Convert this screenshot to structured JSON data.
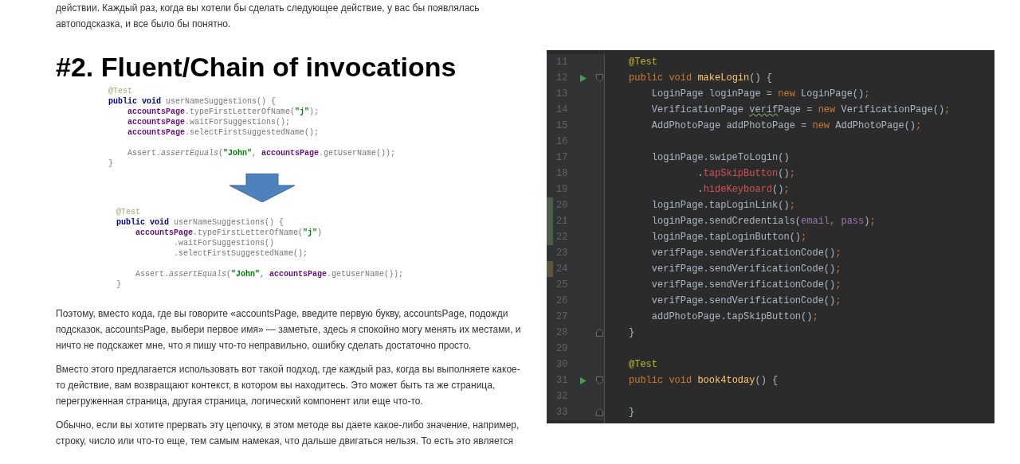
{
  "intro_paragraph": "действии. Каждый раз, когда вы хотели бы сделать следующее действие, у вас бы появлялась автоподсказка, и все было бы понятно.",
  "slide": {
    "title": "#2. Fluent/Chain of invocations",
    "code_before": [
      {
        "kind": "code",
        "segments": [
          {
            "kind": "ann",
            "text": "@Test"
          }
        ]
      },
      {
        "kind": "code",
        "segments": [
          {
            "kind": "kw",
            "text": "public void "
          },
          {
            "kind": "plain",
            "text": "userNameSuggestions() {"
          }
        ]
      },
      {
        "kind": "code",
        "segments": [
          {
            "kind": "obj",
            "text": "    accountsPage"
          },
          {
            "kind": "plain",
            "text": ".typeFirstLetterOfName("
          },
          {
            "kind": "str",
            "text": "\"j\""
          },
          {
            "kind": "plain",
            "text": ");"
          }
        ]
      },
      {
        "kind": "code",
        "segments": [
          {
            "kind": "obj",
            "text": "    accountsPage"
          },
          {
            "kind": "plain",
            "text": ".waitForSuggestions();"
          }
        ]
      },
      {
        "kind": "code",
        "segments": [
          {
            "kind": "obj",
            "text": "    accountsPage"
          },
          {
            "kind": "plain",
            "text": ".selectFirstSuggestedName();"
          }
        ]
      },
      {
        "kind": "blank"
      },
      {
        "kind": "code",
        "segments": [
          {
            "kind": "plain",
            "text": "    Assert."
          },
          {
            "kind": "italic",
            "text": "assertEquals"
          },
          {
            "kind": "plain",
            "text": "("
          },
          {
            "kind": "str",
            "text": "\"John\""
          },
          {
            "kind": "plain",
            "text": ", "
          },
          {
            "kind": "obj",
            "text": "accountsPage"
          },
          {
            "kind": "plain",
            "text": ".getUserName());"
          }
        ]
      },
      {
        "kind": "code",
        "segments": [
          {
            "kind": "plain",
            "text": "}"
          }
        ]
      }
    ],
    "code_after": [
      {
        "kind": "code",
        "segments": [
          {
            "kind": "ann",
            "text": "@Test"
          }
        ]
      },
      {
        "kind": "code",
        "segments": [
          {
            "kind": "kw",
            "text": "public void "
          },
          {
            "kind": "plain",
            "text": "userNameSuggestions() {"
          }
        ]
      },
      {
        "kind": "code",
        "segments": [
          {
            "kind": "obj",
            "text": "    accountsPage"
          },
          {
            "kind": "plain",
            "text": ".typeFirstLetterOfName("
          },
          {
            "kind": "str",
            "text": "\"j\""
          },
          {
            "kind": "plain",
            "text": ")"
          }
        ]
      },
      {
        "kind": "code",
        "segments": [
          {
            "kind": "plain",
            "text": "            .waitForSuggestions()"
          }
        ]
      },
      {
        "kind": "code",
        "segments": [
          {
            "kind": "plain",
            "text": "            .selectFirstSuggestedName();"
          }
        ]
      },
      {
        "kind": "blank"
      },
      {
        "kind": "code",
        "segments": [
          {
            "kind": "plain",
            "text": "    Assert."
          },
          {
            "kind": "italic",
            "text": "assertEquals"
          },
          {
            "kind": "plain",
            "text": "("
          },
          {
            "kind": "str",
            "text": "\"John\""
          },
          {
            "kind": "plain",
            "text": ", "
          },
          {
            "kind": "obj",
            "text": "accountsPage"
          },
          {
            "kind": "plain",
            "text": ".getUserName());"
          }
        ]
      },
      {
        "kind": "code",
        "segments": [
          {
            "kind": "plain",
            "text": "}"
          }
        ]
      }
    ]
  },
  "paragraphs": [
    "Поэтому, вместо кода, где вы говорите «accountsPage, введите первую букву, accountsPage, подожди подсказок, accountsPage, выбери первое имя» — заметьте, здесь я спокойно могу менять их местами, и ничто не подскажет мне, что я пишу что-то неправильно, ошибку сделать достаточно просто.",
    "Вместо этого предлагается использовать вот такой подход, где каждый раз, когда вы выполняете какое-то действие, вам возвращают контекст, в котором вы находитесь. Это может быть та же страница, перегруженная страница, другая страница, логический компонент или еще что-то.",
    "Обычно, если вы хотите прервать эту цепочку, в этом методе вы даете какое-либо значение, например, строку, число или что-то еще, тем самым намекая, что дальше двигаться нельзя. То есть это является"
  ],
  "editor": {
    "lines": [
      {
        "number": "11",
        "segments": [
          {
            "kind": "ann",
            "text": "@Test"
          }
        ]
      },
      {
        "number": "12",
        "run": true,
        "fold_start": true,
        "segments": [
          {
            "kind": "kw",
            "text": "public void "
          },
          {
            "kind": "fn",
            "text": "makeLogin"
          },
          {
            "kind": "plain",
            "text": "() {"
          }
        ]
      },
      {
        "number": "13",
        "segments": [
          {
            "kind": "plain",
            "text": "    LoginPage loginPage = "
          },
          {
            "kind": "kw",
            "text": "new "
          },
          {
            "kind": "plain",
            "text": "LoginPage()"
          },
          {
            "kind": "kw",
            "text": ";"
          }
        ]
      },
      {
        "number": "14",
        "segments": [
          {
            "kind": "plain",
            "text": "    VerificationPage "
          },
          {
            "kind": "warn",
            "text": "verif"
          },
          {
            "kind": "plain",
            "text": "Page = "
          },
          {
            "kind": "kw",
            "text": "new "
          },
          {
            "kind": "plain",
            "text": "VerificationPage()"
          },
          {
            "kind": "kw",
            "text": ";"
          }
        ]
      },
      {
        "number": "15",
        "segments": [
          {
            "kind": "plain",
            "text": "    AddPhotoPage addPhotoPage = "
          },
          {
            "kind": "kw",
            "text": "new "
          },
          {
            "kind": "plain",
            "text": "AddPhotoPage()"
          },
          {
            "kind": "kw",
            "text": ";"
          }
        ]
      },
      {
        "number": "16"
      },
      {
        "number": "17",
        "segments": [
          {
            "kind": "plain",
            "text": "    loginPage.swipeToLogin()"
          }
        ]
      },
      {
        "number": "18",
        "segments": [
          {
            "kind": "plain",
            "text": "            ."
          },
          {
            "kind": "call",
            "text": "tapSkipButton"
          },
          {
            "kind": "plain",
            "text": "()"
          },
          {
            "kind": "kw",
            "text": ";"
          }
        ]
      },
      {
        "number": "19",
        "segments": [
          {
            "kind": "plain",
            "text": "            ."
          },
          {
            "kind": "call",
            "text": "hideKeyboard"
          },
          {
            "kind": "plain",
            "text": "()"
          },
          {
            "kind": "kw",
            "text": ";"
          }
        ]
      },
      {
        "number": "20",
        "added": true,
        "segments": [
          {
            "kind": "plain",
            "text": "    loginPage.tapLoginLink()"
          },
          {
            "kind": "kw",
            "text": ";"
          }
        ]
      },
      {
        "number": "21",
        "added": true,
        "segments": [
          {
            "kind": "plain",
            "text": "    loginPage.sendCredentials("
          },
          {
            "kind": "field",
            "text": "email"
          },
          {
            "kind": "kw",
            "text": ", "
          },
          {
            "kind": "field",
            "text": "pass"
          },
          {
            "kind": "plain",
            "text": ")"
          },
          {
            "kind": "kw",
            "text": ";"
          }
        ]
      },
      {
        "number": "22",
        "added": true,
        "segments": [
          {
            "kind": "plain",
            "text": "    loginPage.tapLoginButton()"
          },
          {
            "kind": "kw",
            "text": ";"
          }
        ]
      },
      {
        "number": "23",
        "segments": [
          {
            "kind": "plain",
            "text": "    verifPage.sendVerificationCode()"
          },
          {
            "kind": "kw",
            "text": ";"
          }
        ]
      },
      {
        "number": "24",
        "modified": true,
        "segments": [
          {
            "kind": "plain",
            "text": "    verifPage.sendVerificationCode()"
          },
          {
            "kind": "kw",
            "text": ";"
          }
        ]
      },
      {
        "number": "25",
        "segments": [
          {
            "kind": "plain",
            "text": "    verifPage.sendVerificationCode()"
          },
          {
            "kind": "kw",
            "text": ";"
          }
        ]
      },
      {
        "number": "26",
        "segments": [
          {
            "kind": "plain",
            "text": "    verifPage.sendVerificationCode()"
          },
          {
            "kind": "kw",
            "text": ";"
          }
        ]
      },
      {
        "number": "27",
        "segments": [
          {
            "kind": "plain",
            "text": "    addPhotoPage.tapSkipButton()"
          },
          {
            "kind": "kw",
            "text": ";"
          }
        ]
      },
      {
        "number": "28",
        "fold_end": true,
        "segments": [
          {
            "kind": "plain",
            "text": "}"
          }
        ]
      },
      {
        "number": "29"
      },
      {
        "number": "30",
        "segments": [
          {
            "kind": "ann",
            "text": "@Test"
          }
        ]
      },
      {
        "number": "31",
        "run": true,
        "fold_start": true,
        "segments": [
          {
            "kind": "kw",
            "text": "public void "
          },
          {
            "kind": "fn",
            "text": "book4today"
          },
          {
            "kind": "plain",
            "text": "() {"
          }
        ]
      },
      {
        "number": "32"
      },
      {
        "number": "33",
        "fold_end": true,
        "segments": [
          {
            "kind": "plain",
            "text": "}"
          }
        ]
      }
    ]
  }
}
